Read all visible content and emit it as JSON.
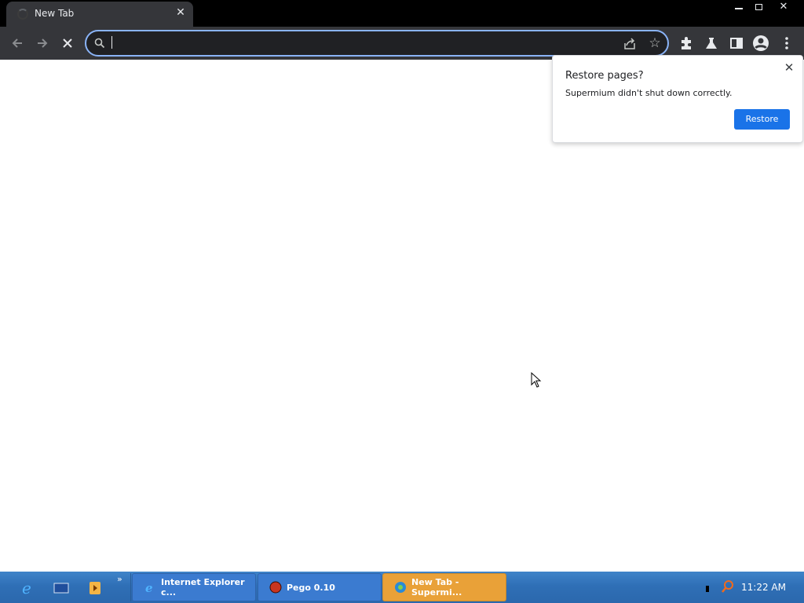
{
  "browser": {
    "tab_title": "New Tab",
    "omnibox_value": ""
  },
  "popup": {
    "title": "Restore pages?",
    "message": "Supermium didn't shut down correctly.",
    "button": "Restore"
  },
  "taskbar": {
    "tasks": [
      {
        "label": "Internet Explorer c...",
        "icon": "internet-explorer-icon"
      },
      {
        "label": "Pego 0.10",
        "icon": "pego-icon"
      },
      {
        "label": "New Tab - Supermi...",
        "icon": "supermium-icon",
        "active": true
      }
    ],
    "more_label": "»",
    "clock": "11:22 AM"
  },
  "colors": {
    "accent": "#1a73e8",
    "omnibox_focus": "#8ab4f8",
    "toolbar": "#35363a",
    "taskbar": "#2f6fb6",
    "active_task": "#e9a138"
  }
}
